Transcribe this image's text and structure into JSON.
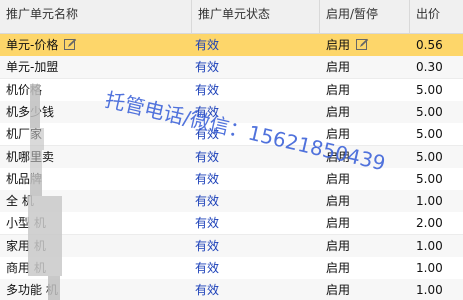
{
  "headers": [
    "推广单元名称",
    "推广单元状态",
    "启用/暂停",
    "出价"
  ],
  "rows": [
    {
      "name": "单元-价格",
      "status": "有效",
      "enable": "启用",
      "bid": "0.56",
      "selected": true
    },
    {
      "name": "单元-加盟",
      "status": "有效",
      "enable": "启用",
      "bid": "0.30"
    },
    {
      "name": "机价格",
      "status": "有效",
      "enable": "启用",
      "bid": "5.00"
    },
    {
      "name": "机多少钱",
      "status": "有效",
      "enable": "启用",
      "bid": "5.00"
    },
    {
      "name": "机厂家",
      "status": "有效",
      "enable": "启用",
      "bid": "5.00"
    },
    {
      "name": "机哪里卖",
      "status": "有效",
      "enable": "启用",
      "bid": "5.00"
    },
    {
      "name": "机品牌",
      "status": "有效",
      "enable": "启用",
      "bid": "5.00"
    },
    {
      "name": "全 机",
      "status": "有效",
      "enable": "启用",
      "bid": "1.00"
    },
    {
      "name": "小型 机",
      "status": "有效",
      "enable": "启用",
      "bid": "2.00"
    },
    {
      "name": "家用 机",
      "status": "有效",
      "enable": "启用",
      "bid": "1.00"
    },
    {
      "name": "商用 机",
      "status": "有效",
      "enable": "启用",
      "bid": "1.00"
    },
    {
      "name": "多功能 机",
      "status": "有效",
      "enable": "启用",
      "bid": "1.00"
    }
  ],
  "watermark": "托管电话/微信：15621850439",
  "colors": {
    "selected_row": "#fdd66a",
    "status_text": "#1a3fb8",
    "watermark": "#3d63d8"
  }
}
